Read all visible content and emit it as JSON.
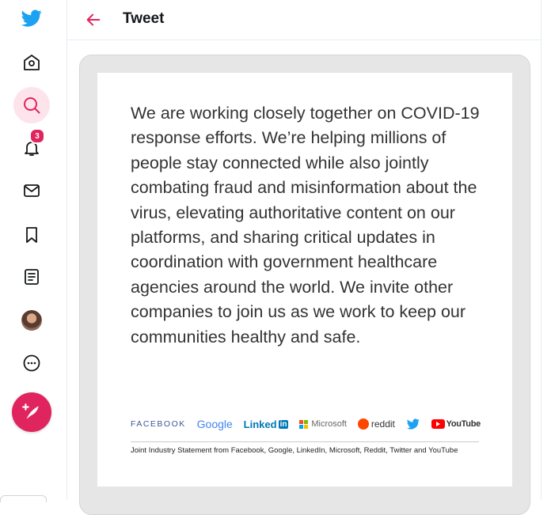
{
  "app": {
    "brand_color": "#1da1f2",
    "accent_color": "#e0245e"
  },
  "sidebar": {
    "items": [
      {
        "name": "home",
        "icon": "home-icon"
      },
      {
        "name": "explore",
        "icon": "search-icon",
        "active": true
      },
      {
        "name": "notifications",
        "icon": "bell-icon",
        "badge": "3"
      },
      {
        "name": "messages",
        "icon": "mail-icon"
      },
      {
        "name": "bookmarks",
        "icon": "bookmark-icon"
      },
      {
        "name": "lists",
        "icon": "list-icon"
      },
      {
        "name": "profile",
        "icon": "avatar"
      },
      {
        "name": "more",
        "icon": "more-icon"
      }
    ],
    "compose_icon": "feather-plus-icon"
  },
  "header": {
    "back_icon": "arrow-left-icon",
    "title": "Tweet"
  },
  "media": {
    "statement": "We are working closely together on COVID-19 response efforts. We’re helping millions of people stay connected while also jointly combating fraud and misinformation about the virus, elevating authoritative content on our platforms, and sharing critical updates in coordination with government healthcare agencies around the world. We invite other companies to join us as we work to keep our communities healthy and safe.",
    "logos": {
      "facebook": "FACEBOOK",
      "google": "Google",
      "linkedin": "Linked",
      "linkedin_in": "in",
      "microsoft": "Microsoft",
      "reddit": "reddit",
      "youtube": "YouTube"
    },
    "caption": "Joint Industry Statement from Facebook, Google, LinkedIn, Microsoft, Reddit, Twitter and YouTube"
  }
}
